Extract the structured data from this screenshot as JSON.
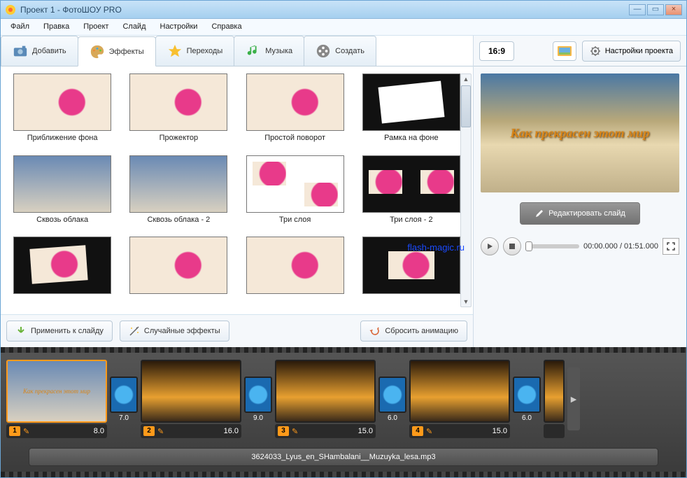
{
  "window": {
    "title": "Проект 1 - ФотоШОУ PRO"
  },
  "menu": [
    "Файл",
    "Правка",
    "Проект",
    "Слайд",
    "Настройки",
    "Справка"
  ],
  "tabs": {
    "add": "Добавить",
    "effects": "Эффекты",
    "transitions": "Переходы",
    "music": "Музыка",
    "create": "Создать"
  },
  "effects": [
    "Приближение фона",
    "Прожектор",
    "Простой поворот",
    "Рамка на фоне",
    "Сквозь облака",
    "Сквозь облака - 2",
    "Три слоя",
    "Три слоя - 2",
    "",
    "",
    "",
    ""
  ],
  "watermark": "flash-magic.ru",
  "effect_buttons": {
    "apply": "Применить к слайду",
    "random": "Случайные эффекты",
    "reset": "Сбросить анимацию"
  },
  "right": {
    "aspect": "16:9",
    "project_settings": "Настройки проекта",
    "preview_text": "Как прекрасен этот мир",
    "edit_slide": "Редактировать слайд",
    "time": "00:00.000 / 01:51.000"
  },
  "timeline": {
    "slides": [
      {
        "num": "1",
        "dur": "8.0",
        "trans": "7.0"
      },
      {
        "num": "2",
        "dur": "16.0",
        "trans": "9.0"
      },
      {
        "num": "3",
        "dur": "15.0",
        "trans": "6.0"
      },
      {
        "num": "4",
        "dur": "15.0",
        "trans": "6.0"
      }
    ],
    "audio": "3624033_Lyus_en_SHambalani__Muzuyka_lesa.mp3"
  }
}
